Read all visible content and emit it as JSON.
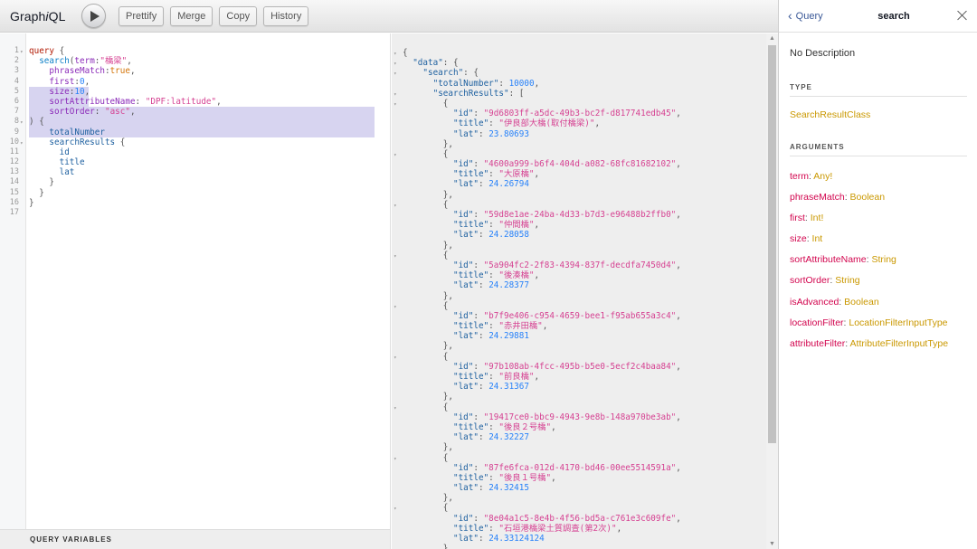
{
  "app": {
    "logo_prefix": "Graph",
    "logo_i": "i",
    "logo_suffix": "QL"
  },
  "toolbar": {
    "prettify": "Prettify",
    "merge": "Merge",
    "copy": "Copy",
    "history": "History"
  },
  "query_editor": {
    "lines": [
      {
        "n": "1",
        "fold": "▾",
        "html": [
          [
            "kw",
            "query"
          ],
          [
            "pun",
            " {"
          ]
        ]
      },
      {
        "n": "2",
        "fold": "",
        "html": [
          [
            "pun",
            "  "
          ],
          [
            "fn",
            "search"
          ],
          [
            "pun",
            "("
          ],
          [
            "arg",
            "term"
          ],
          [
            "pun",
            ":"
          ],
          [
            "str",
            "\"橋梁\""
          ],
          [
            "pun",
            ","
          ]
        ]
      },
      {
        "n": "3",
        "fold": "",
        "html": [
          [
            "pun",
            "    "
          ],
          [
            "arg",
            "phraseMatch"
          ],
          [
            "pun",
            ":"
          ],
          [
            "bool",
            "true"
          ],
          [
            "pun",
            ","
          ]
        ]
      },
      {
        "n": "4",
        "fold": "",
        "html": [
          [
            "pun",
            "    "
          ],
          [
            "arg",
            "first"
          ],
          [
            "pun",
            ":"
          ],
          [
            "num",
            "0"
          ],
          [
            "pun",
            ","
          ]
        ]
      },
      {
        "n": "5",
        "fold": "",
        "html": [
          [
            "pun",
            "    "
          ],
          [
            "arg",
            "size"
          ],
          [
            "pun",
            ":"
          ],
          [
            "num",
            "10"
          ],
          [
            "pun",
            ","
          ]
        ]
      },
      {
        "n": "6",
        "fold": "",
        "html": [
          [
            "pun",
            "    "
          ],
          [
            "arg",
            "sortAttributeName"
          ],
          [
            "pun",
            ": "
          ],
          [
            "str",
            "\"DPF:latitude\""
          ],
          [
            "pun",
            ","
          ]
        ]
      },
      {
        "n": "7",
        "fold": "",
        "html": [
          [
            "pun",
            "    "
          ],
          [
            "arg",
            "sortOrder"
          ],
          [
            "pun",
            ": "
          ],
          [
            "str",
            "\"asc\""
          ],
          [
            "pun",
            ","
          ]
        ]
      },
      {
        "n": "8",
        "fold": "▾",
        "html": [
          [
            "pun",
            ") {"
          ]
        ]
      },
      {
        "n": "9",
        "fold": "",
        "html": [
          [
            "pun",
            "    "
          ],
          [
            "fld",
            "totalNumber"
          ]
        ]
      },
      {
        "n": "10",
        "fold": "▾",
        "html": [
          [
            "pun",
            "    "
          ],
          [
            "fld",
            "searchResults"
          ],
          [
            "pun",
            " {"
          ]
        ]
      },
      {
        "n": "11",
        "fold": "",
        "html": [
          [
            "pun",
            "      "
          ],
          [
            "fld",
            "id"
          ]
        ]
      },
      {
        "n": "12",
        "fold": "",
        "html": [
          [
            "pun",
            "      "
          ],
          [
            "fld",
            "title"
          ]
        ]
      },
      {
        "n": "13",
        "fold": "",
        "html": [
          [
            "pun",
            "      "
          ],
          [
            "fld",
            "lat"
          ]
        ]
      },
      {
        "n": "14",
        "fold": "",
        "html": [
          [
            "pun",
            "    }"
          ]
        ]
      },
      {
        "n": "15",
        "fold": "",
        "html": [
          [
            "pun",
            "  }"
          ]
        ]
      },
      {
        "n": "16",
        "fold": "",
        "html": [
          [
            "pun",
            "}"
          ]
        ]
      },
      {
        "n": "17",
        "fold": "",
        "html": []
      }
    ]
  },
  "query_variables_label": "QUERY VARIABLES",
  "result": {
    "head": [
      {
        "fold": "▾",
        "html": [
          [
            "pun",
            "{"
          ]
        ]
      },
      {
        "fold": "▾",
        "html": [
          [
            "pun",
            "  "
          ],
          [
            "prop",
            "\"data\""
          ],
          [
            "pun",
            ": {"
          ]
        ]
      },
      {
        "fold": "▾",
        "html": [
          [
            "pun",
            "    "
          ],
          [
            "prop",
            "\"search\""
          ],
          [
            "pun",
            ": {"
          ]
        ]
      },
      {
        "fold": "",
        "html": [
          [
            "pun",
            "      "
          ],
          [
            "prop",
            "\"totalNumber\""
          ],
          [
            "pun",
            ": "
          ],
          [
            "num",
            "10000"
          ],
          [
            "pun",
            ","
          ]
        ]
      },
      {
        "fold": "▾",
        "html": [
          [
            "pun",
            "      "
          ],
          [
            "prop",
            "\"searchResults\""
          ],
          [
            "pun",
            ": ["
          ]
        ]
      }
    ],
    "items": [
      {
        "id": "\"9d6803ff-a5dc-49b3-bc2f-d817741edb45\"",
        "title": "\"伊良部大橋(取付橋梁)\"",
        "lat": "23.80693"
      },
      {
        "id": "\"4600a999-b6f4-404d-a082-68fc81682102\"",
        "title": "\"大原橋\"",
        "lat": "24.26794"
      },
      {
        "id": "\"59d8e1ae-24ba-4d33-b7d3-e96488b2ffb0\"",
        "title": "\"仲間橋\"",
        "lat": "24.28058"
      },
      {
        "id": "\"5a904fc2-2f83-4394-837f-decdfa7450d4\"",
        "title": "\"後湊橋\"",
        "lat": "24.28377"
      },
      {
        "id": "\"b7f9e406-c954-4659-bee1-f95ab655a3c4\"",
        "title": "\"赤井田橋\"",
        "lat": "24.29881"
      },
      {
        "id": "\"97b108ab-4fcc-495b-b5e0-5ecf2c4baa84\"",
        "title": "\"前良橋\"",
        "lat": "24.31367"
      },
      {
        "id": "\"19417ce0-bbc9-4943-9e8b-148a970be3ab\"",
        "title": "\"後良２号橋\"",
        "lat": "24.32227"
      },
      {
        "id": "\"87fe6fca-012d-4170-bd46-00ee5514591a\"",
        "title": "\"後良１号橋\"",
        "lat": "24.32415"
      },
      {
        "id": "\"8e04a1c5-8e4b-4f56-bd5a-c761e3c609fe\"",
        "title": "\"石垣港橋梁土質調査(第2次)\"",
        "lat": "24.33124124"
      }
    ]
  },
  "docs": {
    "back_label": "Query",
    "title": "search",
    "description": "No Description",
    "type_heading": "TYPE",
    "type_value": "SearchResultClass",
    "arguments_heading": "ARGUMENTS",
    "arguments": [
      {
        "name": "term",
        "sep": ": ",
        "type": "Any!"
      },
      {
        "name": "phraseMatch",
        "sep": ": ",
        "type": "Boolean"
      },
      {
        "name": "first",
        "sep": ": ",
        "type": "Int!"
      },
      {
        "name": "size",
        "sep": ": ",
        "type": "Int"
      },
      {
        "name": "sortAttributeName",
        "sep": ": ",
        "type": "String"
      },
      {
        "name": "sortOrder",
        "sep": ": ",
        "type": "String"
      },
      {
        "name": "isAdvanced",
        "sep": ": ",
        "type": "Boolean"
      },
      {
        "name": "locationFilter",
        "sep": ": ",
        "type": "LocationFilterInputType"
      },
      {
        "name": "attributeFilter",
        "sep": ": ",
        "type": "AttributeFilterInputType"
      }
    ]
  }
}
